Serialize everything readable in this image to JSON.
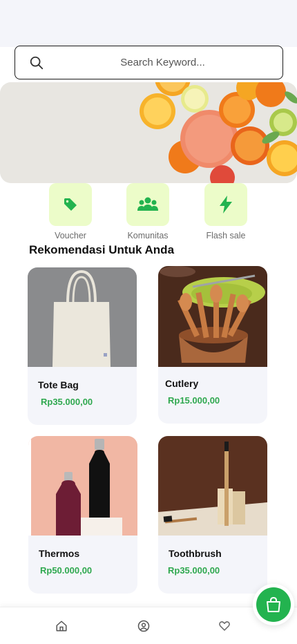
{
  "search": {
    "placeholder": "Search Keyword..."
  },
  "banner": {
    "active_slide": 1,
    "slide_count": 4
  },
  "categories": [
    {
      "label": "Voucher",
      "icon": "tag-icon"
    },
    {
      "label": "Komunitas",
      "icon": "community-icon"
    },
    {
      "label": "Flash sale",
      "icon": "lightning-icon"
    }
  ],
  "section": {
    "title": "Rekomendasi Untuk Anda"
  },
  "products": [
    {
      "name": "Tote Bag",
      "price": "Rp35.000,00"
    },
    {
      "name": "Cutlery",
      "price": "Rp15.000,00"
    },
    {
      "name": "Thermos",
      "price": "Rp50.000,00"
    },
    {
      "name": "Toothbrush",
      "price": "Rp35.000,00"
    }
  ],
  "nav": [
    {
      "icon": "home-icon"
    },
    {
      "icon": "profile-icon"
    },
    {
      "icon": "heart-icon"
    }
  ],
  "cart": {
    "icon": "shopping-bag-icon"
  },
  "colors": {
    "accent_green": "#23b34f",
    "price_green": "#2fa84f",
    "category_tile": "#ecfcc9"
  }
}
